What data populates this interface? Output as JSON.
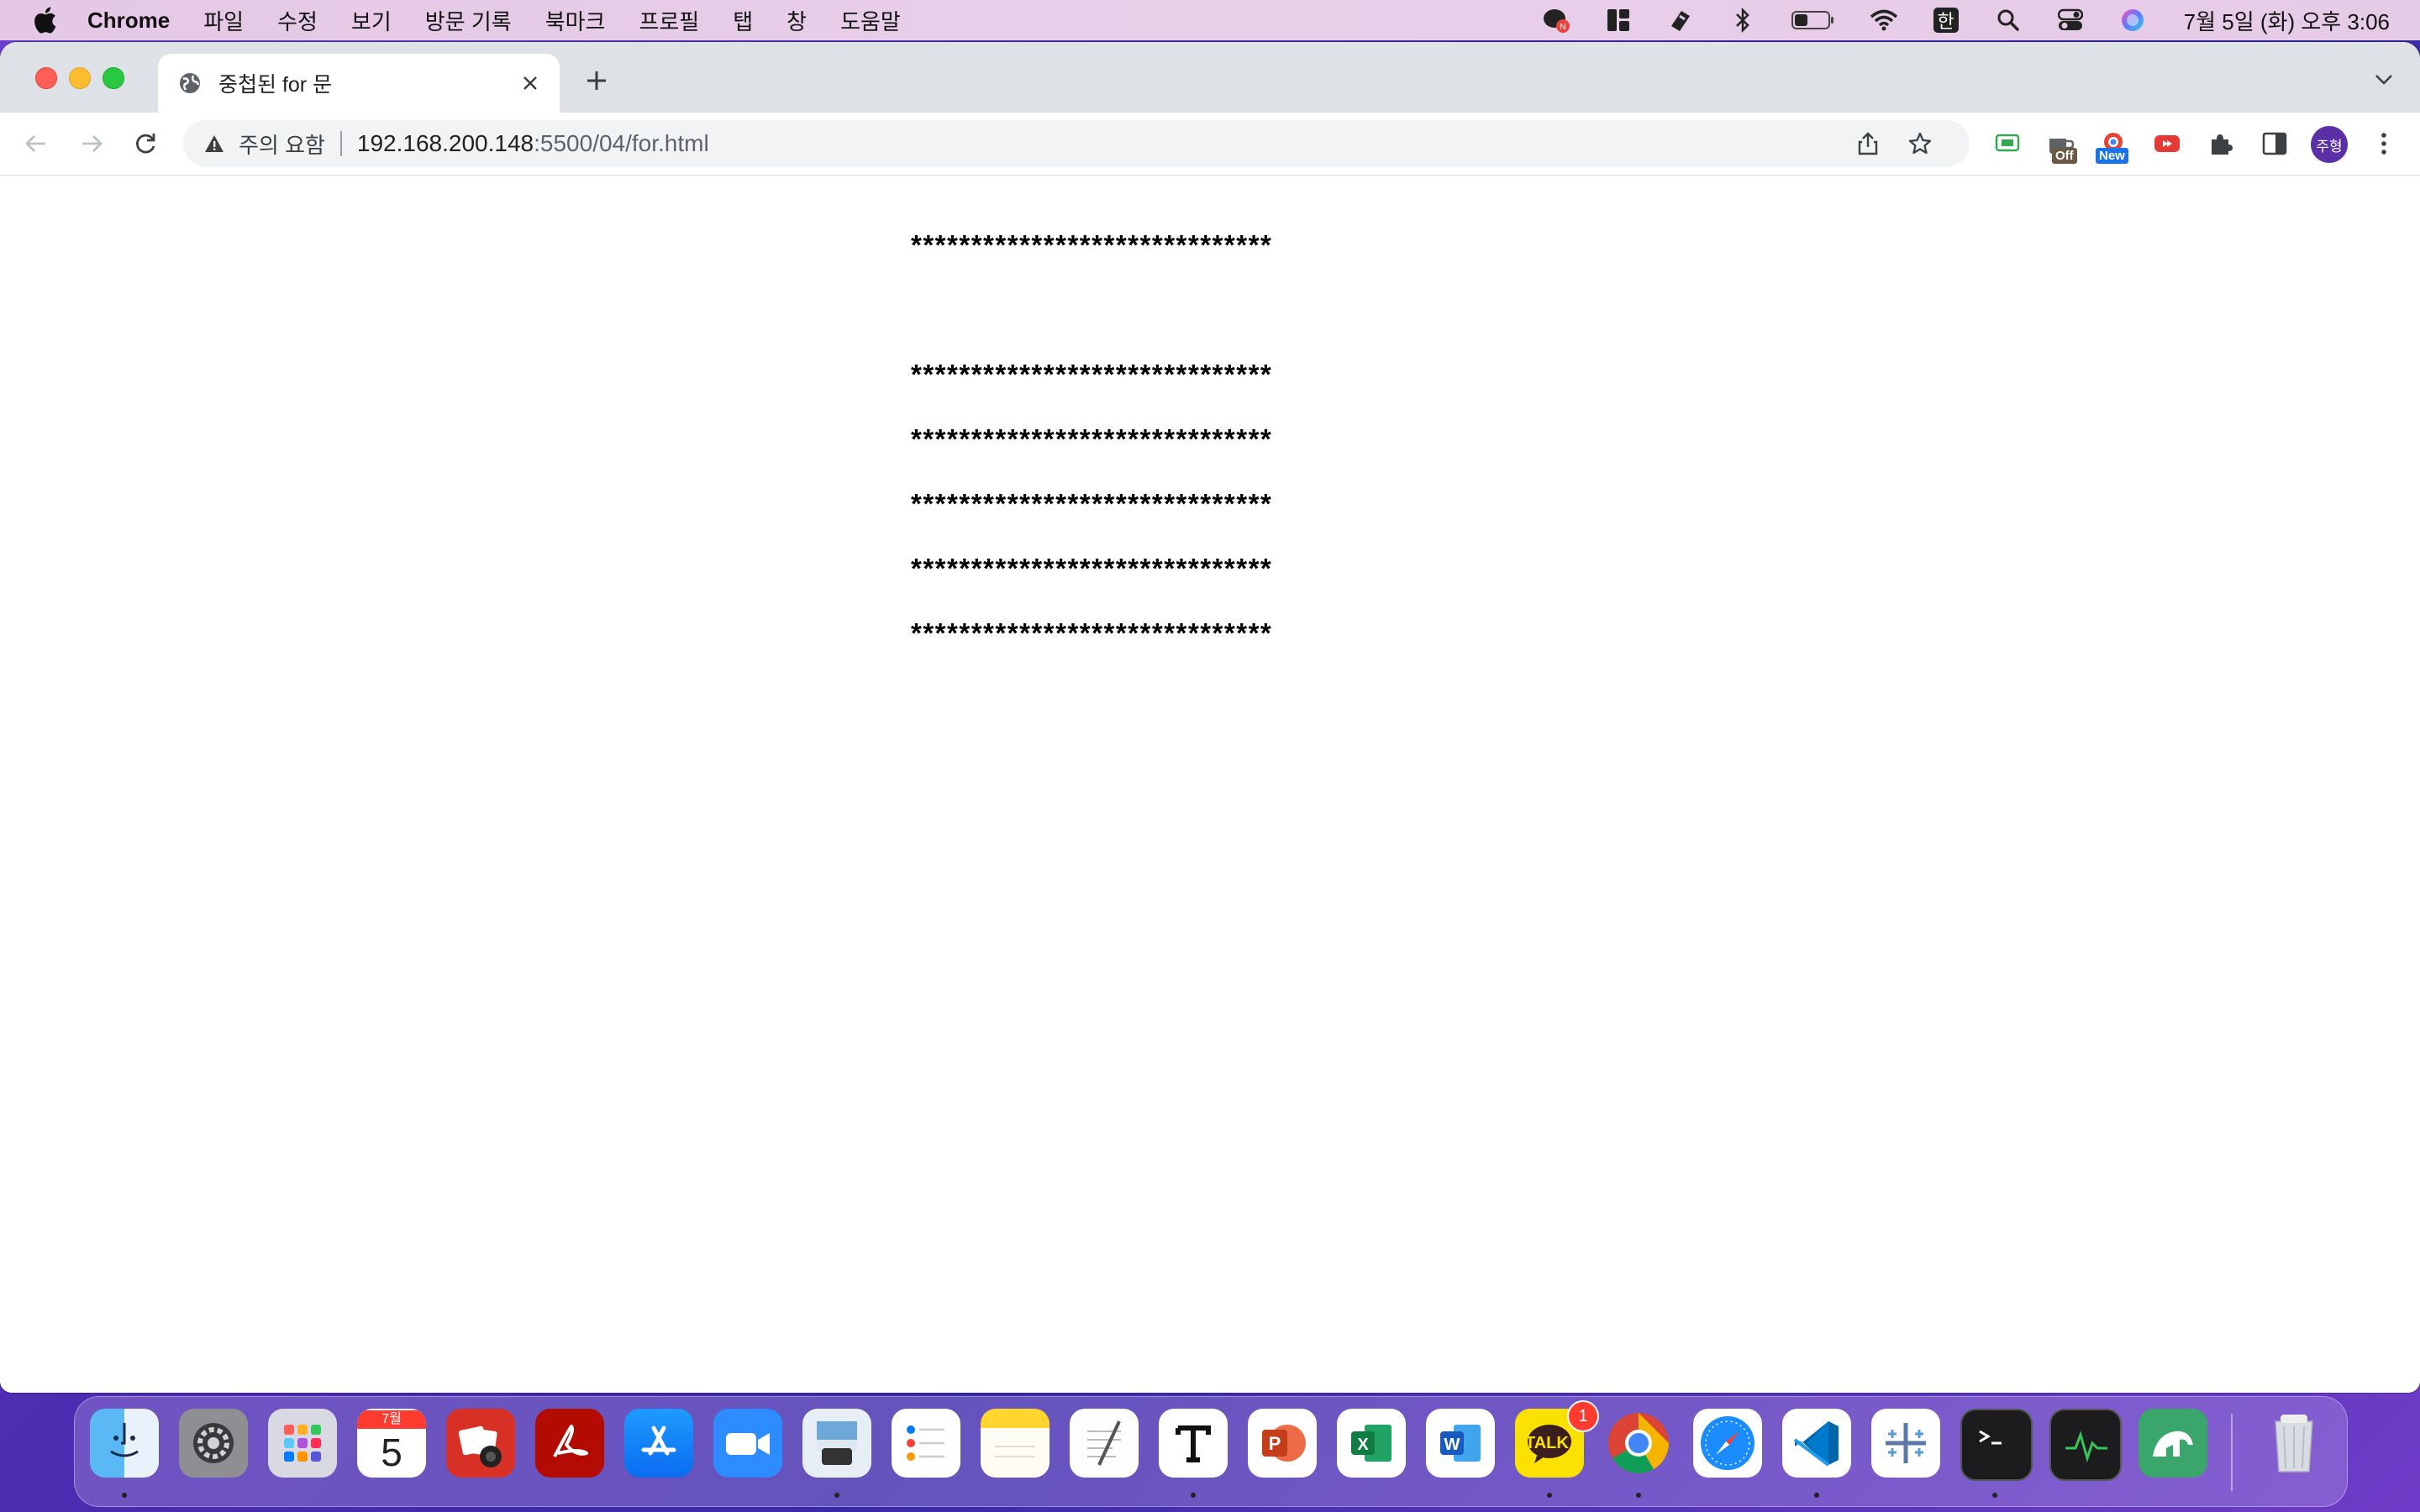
{
  "menubar": {
    "app_name": "Chrome",
    "items": [
      "파일",
      "수정",
      "보기",
      "방문 기록",
      "북마크",
      "프로필",
      "탭",
      "창",
      "도움말"
    ],
    "status_icons": [
      "naver-talk-icon",
      "layout-icon",
      "pen-icon",
      "bluetooth-icon",
      "battery-icon",
      "wifi-icon",
      "input-source-icon",
      "spotlight-icon",
      "control-center-icon",
      "siri-icon"
    ],
    "input_source": "한",
    "clock": "7월 5일 (화) 오후 3:06"
  },
  "tab": {
    "title": "중첩된 for 문"
  },
  "omnibox": {
    "security_label": "주의 요함",
    "host": "192.168.200.148",
    "path": ":5500/04/for.html"
  },
  "extensions": {
    "off_badge": "Off",
    "new_badge": "New"
  },
  "profile": {
    "initials": "주형"
  },
  "page": {
    "lines": [
      "******************************",
      "",
      "******************************",
      "******************************",
      "******************************",
      "******************************",
      "******************************"
    ]
  },
  "dock": {
    "apps": [
      "Finder",
      "System Preferences",
      "Launchpad",
      "Calendar",
      "Photo Booth",
      "Acrobat",
      "App Store",
      "Zoom",
      "Preview",
      "Reminders",
      "Notes",
      "TextEdit",
      "Typora",
      "PowerPoint",
      "Excel",
      "Word",
      "KakaoTalk",
      "Chrome",
      "Safari",
      "VS Code",
      "Tableau",
      "Terminal",
      "Activity Monitor",
      "Stock",
      "Trash"
    ],
    "calendar_month": "7월",
    "calendar_day": "5",
    "kakao_badge": "1",
    "kakao_label": "TALK"
  },
  "colors": {
    "accent": "#1a73e8",
    "profile": "#5b2fa6",
    "warning": "#3c4043"
  }
}
